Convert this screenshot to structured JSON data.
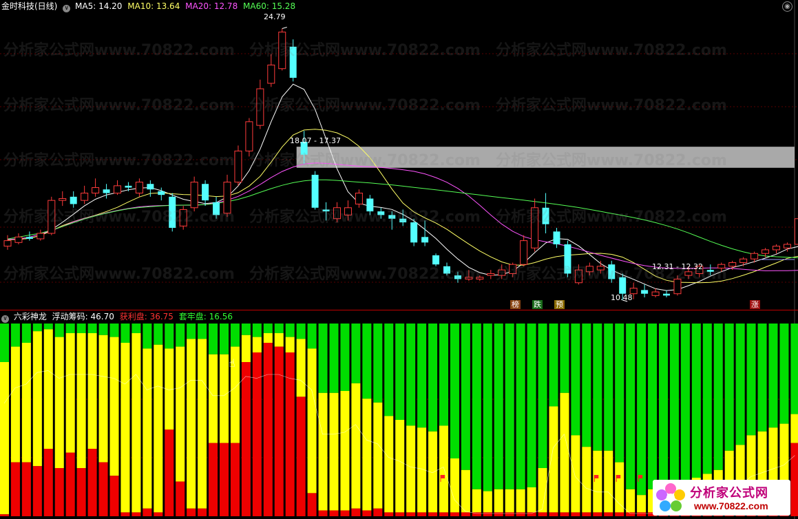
{
  "header": {
    "stock": "金时科技(日线)",
    "ma5": "MA5: 14.20",
    "ma10": "MA10: 13.64",
    "ma20": "MA20: 12.78",
    "ma60": "MA60: 15.28",
    "colors": {
      "ma5": "#ffffff",
      "ma10": "#ffff66",
      "ma20": "#ff55ff",
      "ma60": "#55ff55"
    }
  },
  "subheader": {
    "indicator": "六彩神龙",
    "float": "浮动筹码: 46.70",
    "profit": "获利盘: 36.75",
    "trapped": "套牢盘: 16.56"
  },
  "annotations": {
    "high": "24.79",
    "mid": "18.07 - 17.37",
    "low": "10.48",
    "right": "12.31 - 12.32"
  },
  "tags": [
    "榜",
    "跌",
    "预",
    "涨"
  ],
  "watermark": "分析家公式网www.70822.com",
  "logo": {
    "cn": "分析家公式网",
    "url": "www.70822.com"
  },
  "chart_data": [
    {
      "type": "candlestick",
      "title": "金时科技(日线)",
      "high_label": 24.79,
      "low_label": 10.48,
      "band": [
        17.37,
        18.07
      ],
      "price_range": [
        9.8,
        25.6
      ],
      "bars": [
        {
          "o": 12.9,
          "c": 13.2,
          "h": 13.5,
          "l": 12.7
        },
        {
          "o": 13.1,
          "c": 13.4,
          "h": 13.6,
          "l": 13.0
        },
        {
          "o": 13.4,
          "c": 13.3,
          "h": 13.7,
          "l": 13.2
        },
        {
          "o": 13.3,
          "c": 13.6,
          "h": 13.8,
          "l": 13.2
        },
        {
          "o": 13.6,
          "c": 15.4,
          "h": 15.6,
          "l": 13.5
        },
        {
          "o": 15.4,
          "c": 15.5,
          "h": 15.9,
          "l": 15.1
        },
        {
          "o": 15.6,
          "c": 15.2,
          "h": 15.9,
          "l": 15.0
        },
        {
          "o": 15.4,
          "c": 15.8,
          "h": 16.2,
          "l": 15.2
        },
        {
          "o": 15.8,
          "c": 16.1,
          "h": 16.6,
          "l": 15.6
        },
        {
          "o": 16.0,
          "c": 15.8,
          "h": 16.3,
          "l": 15.5
        },
        {
          "o": 15.8,
          "c": 16.2,
          "h": 16.5,
          "l": 15.7
        },
        {
          "o": 16.2,
          "c": 16.1,
          "h": 16.4,
          "l": 15.9
        },
        {
          "o": 15.8,
          "c": 16.4,
          "h": 16.6,
          "l": 15.6
        },
        {
          "o": 16.3,
          "c": 16.0,
          "h": 16.5,
          "l": 15.6
        },
        {
          "o": 15.9,
          "c": 15.7,
          "h": 16.1,
          "l": 15.4
        },
        {
          "o": 15.6,
          "c": 13.9,
          "h": 15.8,
          "l": 13.7
        },
        {
          "o": 14.0,
          "c": 14.9,
          "h": 15.1,
          "l": 13.8
        },
        {
          "o": 15.0,
          "c": 16.4,
          "h": 16.7,
          "l": 14.8
        },
        {
          "o": 16.3,
          "c": 15.4,
          "h": 16.5,
          "l": 15.1
        },
        {
          "o": 15.3,
          "c": 14.6,
          "h": 15.6,
          "l": 14.4
        },
        {
          "o": 14.7,
          "c": 16.4,
          "h": 16.8,
          "l": 14.5
        },
        {
          "o": 16.4,
          "c": 18.1,
          "h": 18.4,
          "l": 16.2
        },
        {
          "o": 18.1,
          "c": 19.7,
          "h": 19.9,
          "l": 17.8
        },
        {
          "o": 19.5,
          "c": 21.5,
          "h": 22.0,
          "l": 19.3
        },
        {
          "o": 21.8,
          "c": 22.8,
          "h": 23.4,
          "l": 21.6
        },
        {
          "o": 22.6,
          "c": 24.6,
          "h": 24.79,
          "l": 22.5
        },
        {
          "o": 23.8,
          "c": 22.1,
          "h": 24.2,
          "l": 21.9
        },
        {
          "o": 18.6,
          "c": 17.9,
          "h": 19.2,
          "l": 17.4
        },
        {
          "o": 16.8,
          "c": 15.0,
          "h": 17.0,
          "l": 14.9
        },
        {
          "o": 14.9,
          "c": 14.8,
          "h": 15.3,
          "l": 14.3
        },
        {
          "o": 14.4,
          "c": 15.0,
          "h": 15.3,
          "l": 14.2
        },
        {
          "o": 14.6,
          "c": 15.0,
          "h": 15.4,
          "l": 14.3
        },
        {
          "o": 15.2,
          "c": 15.8,
          "h": 16.0,
          "l": 15.0
        },
        {
          "o": 15.5,
          "c": 14.8,
          "h": 15.7,
          "l": 14.6
        },
        {
          "o": 14.8,
          "c": 14.6,
          "h": 15.0,
          "l": 14.4
        },
        {
          "o": 14.6,
          "c": 14.4,
          "h": 14.8,
          "l": 13.8
        },
        {
          "o": 14.4,
          "c": 14.2,
          "h": 14.9,
          "l": 14.0
        },
        {
          "o": 14.2,
          "c": 13.1,
          "h": 14.4,
          "l": 12.9
        },
        {
          "o": 13.4,
          "c": 13.1,
          "h": 14.3,
          "l": 12.9
        },
        {
          "o": 12.4,
          "c": 11.9,
          "h": 12.5,
          "l": 11.8
        },
        {
          "o": 11.8,
          "c": 11.4,
          "h": 12.0,
          "l": 11.3
        },
        {
          "o": 11.3,
          "c": 11.1,
          "h": 11.5,
          "l": 10.9
        },
        {
          "o": 11.1,
          "c": 11.2,
          "h": 11.6,
          "l": 11.0
        },
        {
          "o": 11.1,
          "c": 11.2,
          "h": 11.3,
          "l": 11.0
        },
        {
          "o": 11.3,
          "c": 11.4,
          "h": 11.6,
          "l": 11.1
        },
        {
          "o": 11.3,
          "c": 11.6,
          "h": 11.9,
          "l": 11.1
        },
        {
          "o": 11.4,
          "c": 11.9,
          "h": 12.0,
          "l": 11.2
        },
        {
          "o": 11.9,
          "c": 13.2,
          "h": 13.5,
          "l": 11.8
        },
        {
          "o": 12.8,
          "c": 15.0,
          "h": 15.5,
          "l": 12.6
        },
        {
          "o": 15.0,
          "c": 14.1,
          "h": 15.8,
          "l": 13.6
        },
        {
          "o": 13.7,
          "c": 13.0,
          "h": 13.9,
          "l": 12.8
        },
        {
          "o": 13.0,
          "c": 11.4,
          "h": 13.2,
          "l": 11.2
        },
        {
          "o": 10.9,
          "c": 11.6,
          "h": 11.9,
          "l": 10.8
        },
        {
          "o": 11.5,
          "c": 11.8,
          "h": 12.0,
          "l": 11.3
        },
        {
          "o": 11.6,
          "c": 11.8,
          "h": 12.1,
          "l": 11.4
        },
        {
          "o": 11.9,
          "c": 11.1,
          "h": 12.1,
          "l": 10.9
        },
        {
          "o": 11.2,
          "c": 10.3,
          "h": 11.4,
          "l": 9.95
        },
        {
          "o": 10.3,
          "c": 10.6,
          "h": 10.9,
          "l": 10.0
        },
        {
          "o": 10.5,
          "c": 10.3,
          "h": 10.8,
          "l": 10.1
        },
        {
          "o": 10.2,
          "c": 10.4,
          "h": 10.6,
          "l": 10.1
        },
        {
          "o": 10.3,
          "c": 10.2,
          "h": 10.5,
          "l": 10.1
        },
        {
          "o": 10.3,
          "c": 11.1,
          "h": 11.3,
          "l": 10.2
        },
        {
          "o": 11.3,
          "c": 11.5,
          "h": 11.8,
          "l": 11.1
        },
        {
          "o": 11.4,
          "c": 11.8,
          "h": 11.9,
          "l": 11.2
        },
        {
          "o": 11.6,
          "c": 11.5,
          "h": 11.9,
          "l": 11.3
        },
        {
          "o": 11.7,
          "c": 11.9,
          "h": 12.0,
          "l": 11.5
        },
        {
          "o": 11.8,
          "c": 12.0,
          "h": 12.1,
          "l": 11.6
        },
        {
          "o": 12.0,
          "c": 12.2,
          "h": 12.3,
          "l": 11.8
        },
        {
          "o": 12.2,
          "c": 12.5,
          "h": 12.6,
          "l": 12.0
        },
        {
          "o": 12.5,
          "c": 12.7,
          "h": 12.8,
          "l": 12.3
        },
        {
          "o": 12.7,
          "c": 12.9,
          "h": 13.0,
          "l": 12.5
        },
        {
          "o": 12.8,
          "c": 13.0,
          "h": 13.1,
          "l": 12.6
        },
        {
          "o": 13.0,
          "c": 14.4,
          "h": 14.6,
          "l": 12.9
        }
      ]
    },
    {
      "type": "area",
      "title": "六彩神龙",
      "series_names": [
        "获利盘",
        "浮动筹码",
        "套牢盘"
      ],
      "colors": {
        "profit": "#ee0000",
        "float": "#ffff00",
        "trapped": "#00dd00"
      },
      "note": "per-bar percentage heights of red (profit), yellow (float), green (trapped); values from bottom",
      "profit": [
        1,
        28,
        28,
        26,
        35,
        25,
        33,
        25,
        35,
        28,
        21,
        2,
        2,
        4,
        2,
        45,
        18,
        4,
        4,
        38,
        38,
        38,
        80,
        85,
        90,
        88,
        85,
        62,
        12,
        3,
        3,
        3,
        4,
        3,
        4,
        2,
        2,
        2,
        2,
        2,
        2,
        2,
        2,
        2,
        2,
        2,
        2,
        2,
        2,
        2,
        2,
        2,
        2,
        2,
        2,
        2,
        2,
        2,
        2,
        2,
        2,
        2,
        2,
        2,
        2,
        2,
        2,
        2,
        2,
        2,
        2,
        2,
        38
      ],
      "float": [
        79,
        60,
        62,
        70,
        62,
        68,
        62,
        70,
        60,
        66,
        72,
        88,
        93,
        83,
        87,
        42,
        70,
        88,
        88,
        46,
        46,
        50,
        14,
        8,
        5,
        7,
        8,
        30,
        75,
        61,
        61,
        62,
        65,
        58,
        55,
        50,
        48,
        45,
        44,
        42,
        45,
        28,
        22,
        12,
        11,
        12,
        12,
        12,
        13,
        23,
        55,
        62,
        40,
        34,
        32,
        32,
        26,
        12,
        9,
        12,
        10,
        12,
        14,
        18,
        20,
        22,
        32,
        35,
        40,
        42,
        44,
        46,
        15
      ],
      "trapped": [
        20,
        12,
        10,
        4,
        3,
        7,
        5,
        5,
        5,
        6,
        7,
        10,
        5,
        13,
        11,
        13,
        12,
        8,
        8,
        16,
        16,
        12,
        6,
        7,
        5,
        5,
        7,
        8,
        13,
        36,
        36,
        35,
        31,
        39,
        41,
        48,
        50,
        53,
        54,
        56,
        53,
        70,
        76,
        86,
        87,
        86,
        86,
        86,
        85,
        75,
        43,
        36,
        58,
        64,
        66,
        66,
        72,
        86,
        89,
        86,
        88,
        86,
        84,
        80,
        78,
        76,
        66,
        63,
        58,
        56,
        54,
        52,
        47
      ]
    }
  ]
}
